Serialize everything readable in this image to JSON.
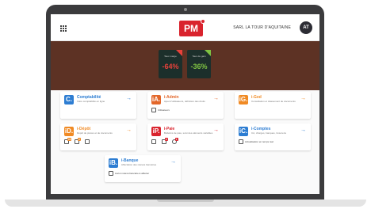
{
  "header": {
    "logo": "PM",
    "store_label": "SARL LA TOUR D'AQUITAINE",
    "avatar_initials": "AT"
  },
  "kpis": [
    {
      "label": "Taux marge",
      "value": "-64%",
      "color": "#e8413a",
      "corner": "#e8413a"
    },
    {
      "label": "Taux de gain",
      "value": "-36%",
      "color": "#7ec242",
      "corner": "#7ec242"
    }
  ],
  "cards": [
    {
      "badge": "C.",
      "title": "Comptabilité",
      "subtitle": "Votre comptabilité en ligne",
      "color": "#2d7dd2",
      "footer": ""
    },
    {
      "badge": "iA.",
      "title": "i-Admin",
      "subtitle": "Ajout d'utilisateurs, définition des droits",
      "color": "#e3672a",
      "footer": "Utilisateurs"
    },
    {
      "badge": "iG.",
      "title": "i-Ged",
      "subtitle": "Consultation et classement de documents",
      "color": "#f08a24",
      "footer": ""
    },
    {
      "badge": "iD.",
      "title": "i-Dépôt",
      "subtitle": "Dépôt de pièces et de documents",
      "color": "#f08a24",
      "footer": ""
    },
    {
      "badge": "iP.",
      "title": "i-Paie",
      "subtitle": "Bulletins de paie, suivi des éléments variables",
      "color": "#d9232d",
      "footer": ""
    },
    {
      "badge": "iC.",
      "title": "i-Comptes",
      "subtitle": "CA, charges, banques, trésorerie",
      "color": "#2d7dd2",
      "footer": "Actualisation en temps réel"
    },
    {
      "badge": "iB.",
      "title": "i-Banque",
      "subtitle": "Affectation des relevés bancaires",
      "color": "#2d7dd2",
      "footer": "Aucun relevé bancaire à affecter"
    }
  ],
  "counters": {
    "depot": [
      "12",
      "3"
    ],
    "paie": [
      "2",
      "1"
    ]
  }
}
